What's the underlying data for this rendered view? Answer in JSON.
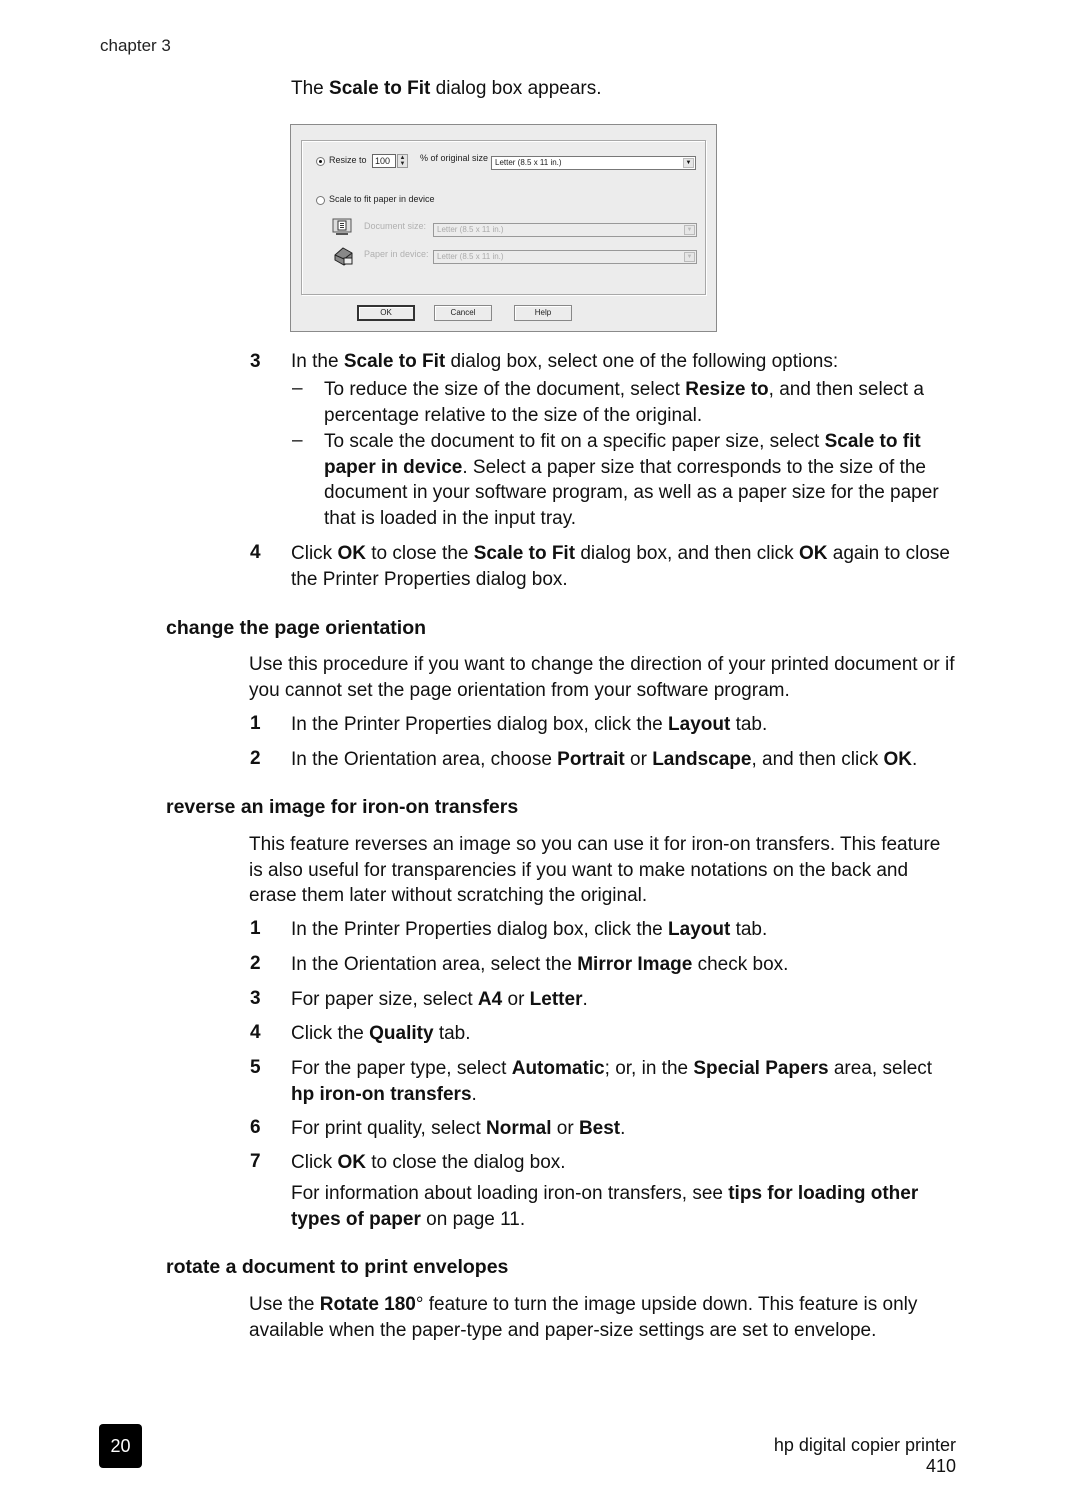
{
  "header": {
    "chapter": "chapter 3"
  },
  "intro": {
    "pre": "The ",
    "bold": "Scale to Fit",
    "post": " dialog box appears."
  },
  "dialog": {
    "resize_radio_label": "Resize to",
    "resize_value": "100",
    "percent_label": "% of original size",
    "paper_select_value": "Letter (8.5 x 11 in.)",
    "scale_radio_label": "Scale to fit paper in device",
    "document_size_label": "Document size:",
    "document_size_value": "Letter (8.5 x 11 in.)",
    "paper_in_device_label": "Paper in device:",
    "paper_in_device_value": "Letter (8.5 x 11 in.)",
    "ok_label": "OK",
    "cancel_label": "Cancel",
    "help_label": "Help",
    "selected_option": "Resize to"
  },
  "steps_a": [
    {
      "num": "3",
      "parts": [
        "In the ",
        {
          "b": "Scale to Fit"
        },
        " dialog box, select one of the following options:"
      ]
    },
    {
      "num": "4",
      "parts": [
        "Click ",
        {
          "b": "OK"
        },
        " to close the ",
        {
          "b": "Scale to Fit"
        },
        " dialog box, and then click ",
        {
          "b": "OK"
        },
        " again to close the Printer Properties dialog box."
      ]
    }
  ],
  "bullets": [
    {
      "dash": "–",
      "parts": [
        "To reduce the size of the document, select ",
        {
          "b": "Resize to"
        },
        ", and then select a percentage relative to the size of the original."
      ]
    },
    {
      "dash": "–",
      "parts": [
        "To scale the document to fit on a specific paper size, select ",
        {
          "b": "Scale to fit paper in device"
        },
        ". Select a paper size that corresponds to the size of the document in your software program, as well as a paper size for the paper that is loaded in the input tray."
      ]
    }
  ],
  "section_orientation": {
    "title": "change the page orientation",
    "intro": "Use this procedure if you want to change the direction of your printed document or if you cannot set the page orientation from your software program.",
    "steps": [
      {
        "num": "1",
        "parts": [
          "In the Printer Properties dialog box, click the ",
          {
            "b": "Layout"
          },
          " tab."
        ]
      },
      {
        "num": "2",
        "parts": [
          "In the Orientation area, choose ",
          {
            "b": "Portrait"
          },
          " or ",
          {
            "b": "Landscape"
          },
          ", and then click ",
          {
            "b": "OK"
          },
          "."
        ]
      }
    ]
  },
  "section_reverse": {
    "title": "reverse an image for iron-on transfers",
    "intro": "This feature reverses an image so you can use it for iron-on transfers. This feature is also useful for transparencies if you want to make notations on the back and erase them later without scratching the original.",
    "steps": [
      {
        "num": "1",
        "parts": [
          "In the Printer Properties dialog box, click the ",
          {
            "b": "Layout"
          },
          " tab."
        ]
      },
      {
        "num": "2",
        "parts": [
          "In the Orientation area, select the ",
          {
            "b": "Mirror Image"
          },
          " check box."
        ]
      },
      {
        "num": "3",
        "parts": [
          "For paper size, select ",
          {
            "b": "A4"
          },
          " or ",
          {
            "b": "Letter"
          },
          "."
        ]
      },
      {
        "num": "4",
        "parts": [
          "Click the ",
          {
            "b": "Quality"
          },
          " tab."
        ]
      },
      {
        "num": "5",
        "parts": [
          "For the paper type, select ",
          {
            "b": "Automatic"
          },
          "; or, in the ",
          {
            "b": "Special Papers"
          },
          " area, select ",
          {
            "b": "hp iron-on transfers"
          },
          "."
        ]
      },
      {
        "num": "6",
        "parts": [
          "For print quality, select ",
          {
            "b": "Normal"
          },
          " or ",
          {
            "b": "Best"
          },
          "."
        ]
      },
      {
        "num": "7",
        "parts": [
          "Click ",
          {
            "b": "OK"
          },
          " to close the dialog box."
        ]
      }
    ],
    "note": [
      "For information about loading iron-on transfers, see ",
      {
        "b": "tips for loading other types of paper"
      },
      " on page 11."
    ]
  },
  "section_rotate": {
    "title": "rotate a document to print envelopes",
    "intro": [
      "Use the ",
      {
        "b": "Rotate 180"
      },
      "° feature to turn the image upside down. This feature is only available when the paper-type and paper-size settings are set to envelope."
    ]
  },
  "footer": {
    "page_number": "20",
    "product": "hp digital copier printer 410"
  }
}
